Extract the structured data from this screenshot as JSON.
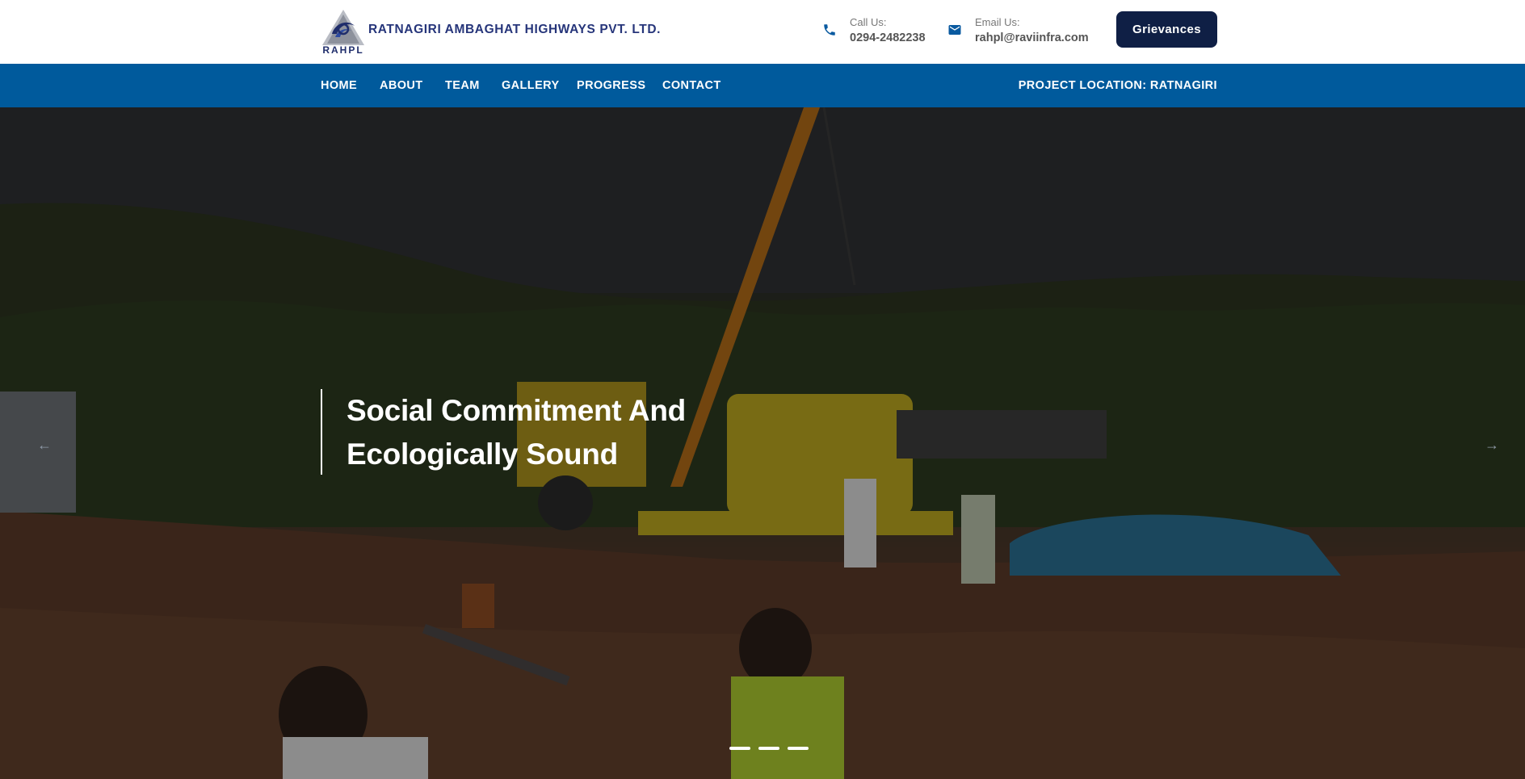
{
  "header": {
    "company_name": "RATNAGIRI AMBAGHAT HIGHWAYS PVT. LTD.",
    "logo_abbr": "RAHPL",
    "phone": {
      "label": "Call Us:",
      "value": "0294-2482238",
      "icon": "phone-icon"
    },
    "email": {
      "label": "Email Us:",
      "value": "rahpl@raviinfra.com",
      "icon": "mail-icon"
    },
    "grievances_label": "Grievances"
  },
  "nav": {
    "items": [
      {
        "label": "HOME"
      },
      {
        "label": "ABOUT"
      },
      {
        "label": "TEAM"
      },
      {
        "label": "GALLERY"
      },
      {
        "label": "PROGRESS"
      },
      {
        "label": "CONTACT"
      }
    ],
    "location": "PROJECT LOCATION: RATNAGIRI"
  },
  "hero": {
    "caption_line1": "Social Commitment And",
    "caption_line2": "Ecologically Sound",
    "prev_arrow": "←",
    "next_arrow": "→",
    "slide_count": 3,
    "active_slide": 1
  },
  "colors": {
    "brand_navy": "#26357a",
    "nav_blue": "#005a9c",
    "button_dark": "#0f1f45",
    "text_white": "#ffffff"
  }
}
